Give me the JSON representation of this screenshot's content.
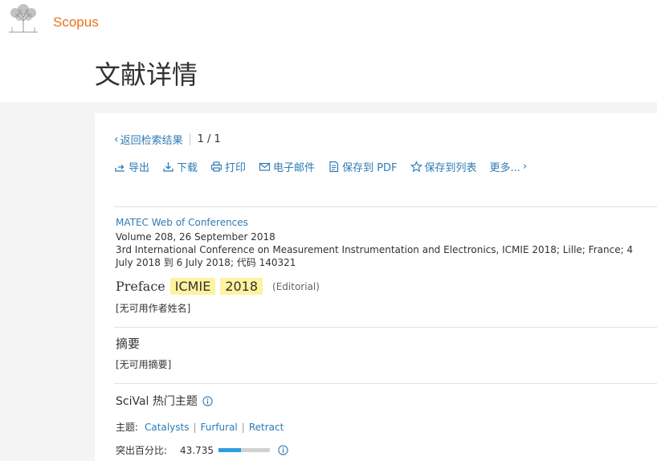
{
  "header": {
    "brand": "Scopus",
    "page_title": "文献详情"
  },
  "nav": {
    "back_label": "返回检索结果",
    "count": "1  /  1"
  },
  "toolbar": {
    "export": "导出",
    "download": "下载",
    "print": "打印",
    "email": "电子邮件",
    "save_pdf": "保存到 PDF",
    "save_list": "保存到列表",
    "more": "更多..."
  },
  "document": {
    "source": "MATEC Web of Conferences",
    "volume": "Volume 208, 26 September 2018",
    "conference": "3rd International Conference on Measurement Instrumentation and Electronics, ICMIE 2018; Lille; France; 4 July 2018 到 6 July 2018; 代码 140321",
    "title_prefix": "Preface",
    "title_hl1": "ICMIE",
    "title_hl2": "2018",
    "doc_type": "(Editorial)",
    "authors": "[无可用作者姓名]"
  },
  "abstract": {
    "heading": "摘要",
    "text": "[无可用摘要]"
  },
  "scival": {
    "heading": "SciVal 热门主题",
    "topics_label": "主题:",
    "topics": [
      "Catalysts",
      "Furfural",
      "Retract"
    ],
    "prominence_label": "突出百分比:",
    "prominence_value": "43.735",
    "prominence_percent": 43.735
  },
  "colors": {
    "brand": "#e9711c",
    "link": "#2e7bb5",
    "highlight": "#fff2a0",
    "bar_fill": "#2d9ee0"
  }
}
